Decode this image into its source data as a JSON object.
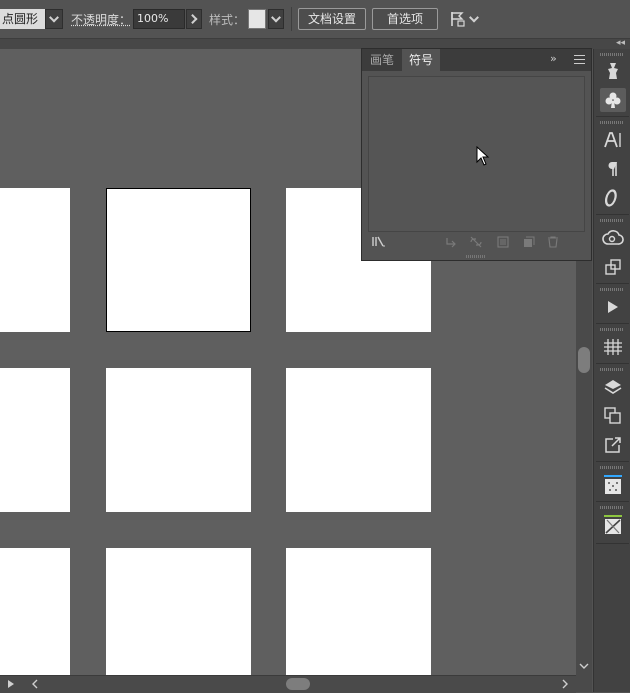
{
  "control_bar": {
    "shape_name": "点圆形",
    "opacity_label": "不透明度：",
    "opacity_value": "100%",
    "style_label": "样式：",
    "doc_setup_label": "文档设置",
    "preferences_label": "首选项"
  },
  "symbols_panel": {
    "tabs": [
      {
        "label": "画笔",
        "active": false
      },
      {
        "label": "符号",
        "active": true
      }
    ]
  },
  "artboards": {
    "rows": 3,
    "columns": 3,
    "selected": {
      "row": 1,
      "column": 2
    }
  },
  "colors": {
    "app_bg": "#535353",
    "canvas_bg": "#5f5f5f",
    "artboard": "#ffffff",
    "cc_accent": "#31a8ff",
    "swatch_accent": "#8dc63f"
  },
  "right_strip_icons": [
    "puppet-warp-icon",
    "symbol-club-icon",
    "character-icon",
    "paragraph-icon",
    "opentype-icon",
    "creative-cloud-libraries-icon",
    "transform-icon",
    "actions-play-icon",
    "align-grid-icon",
    "layers-icon",
    "artboards-icon",
    "export-icon",
    "swatches-icon",
    "gradient-icon"
  ]
}
